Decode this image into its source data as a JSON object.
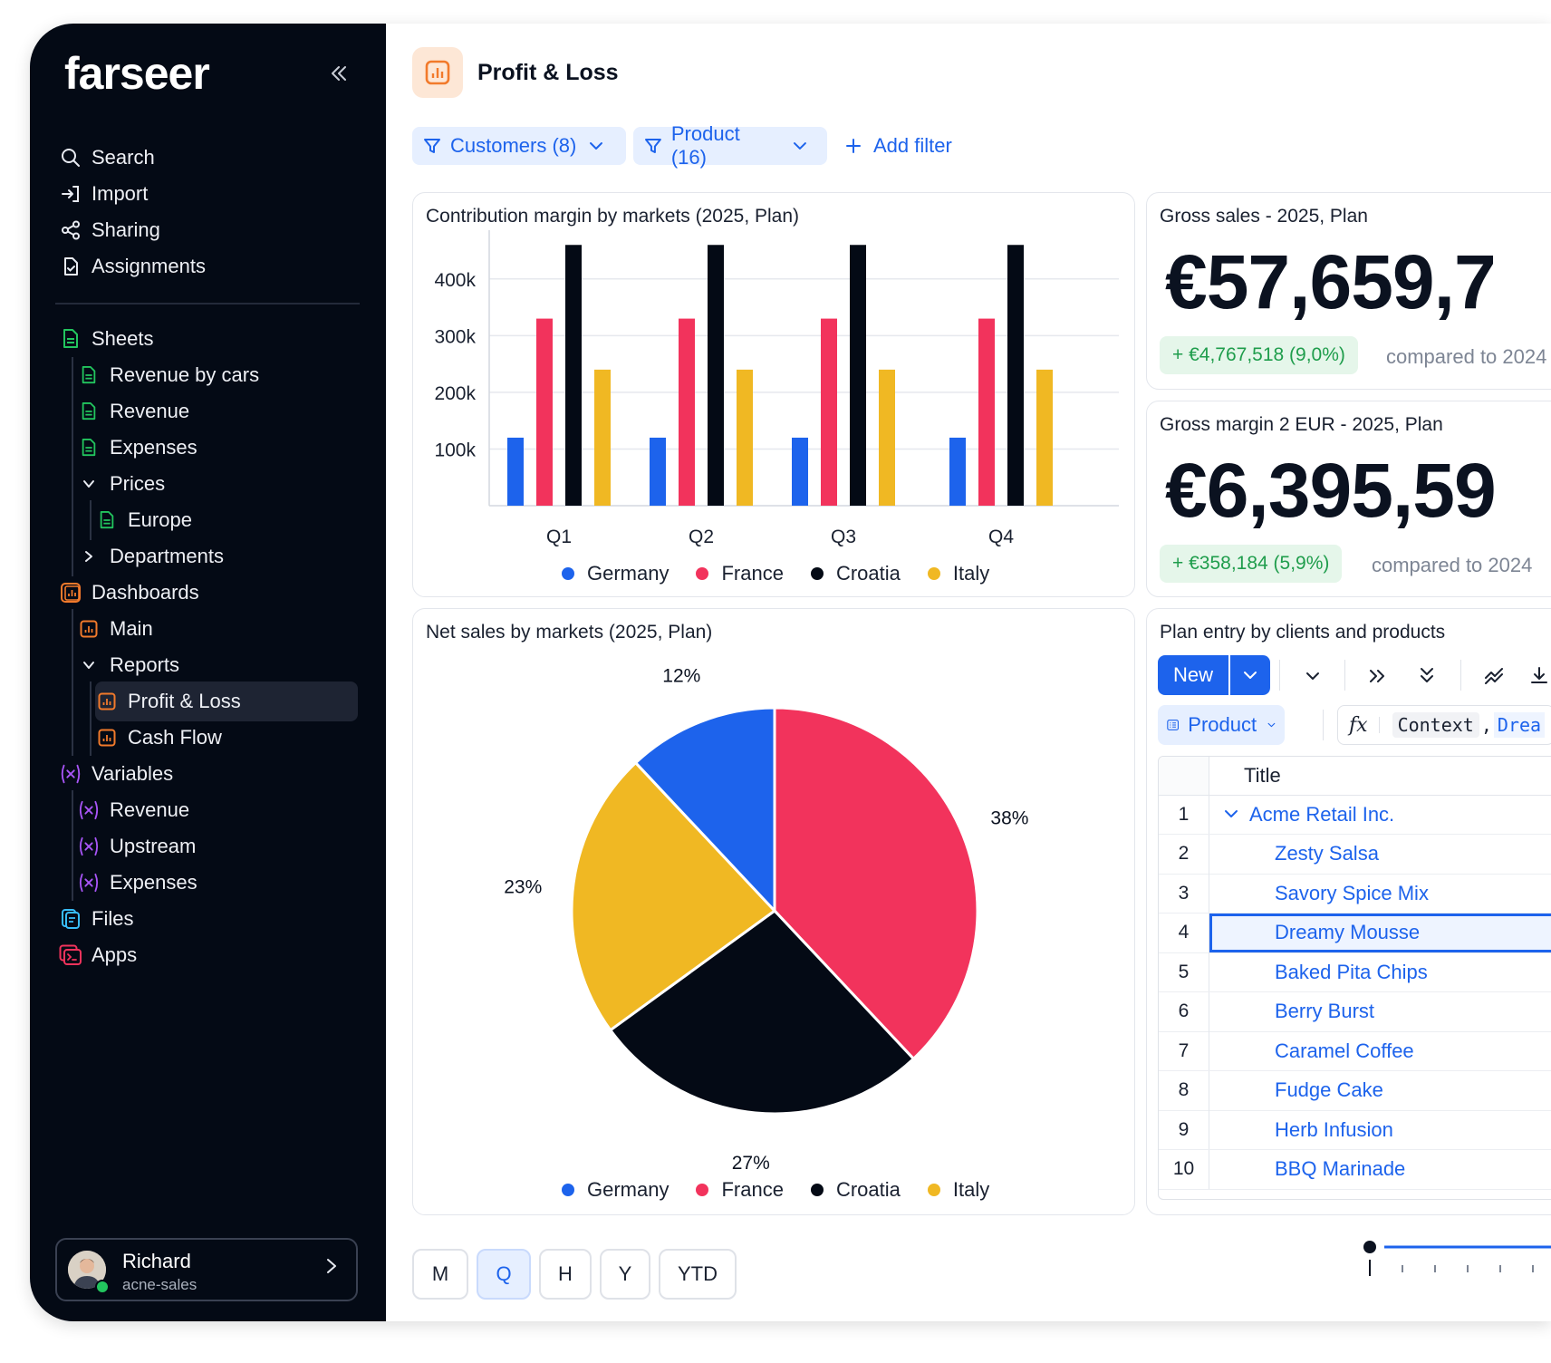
{
  "app": {
    "logo": "farseer",
    "collapse_icon": "double-chevron-left-icon"
  },
  "sidebar": {
    "top_items": [
      {
        "label": "Search",
        "icon": "search-icon"
      },
      {
        "label": "Import",
        "icon": "import-icon"
      },
      {
        "label": "Sharing",
        "icon": "share-icon"
      },
      {
        "label": "Assignments",
        "icon": "assignment-icon"
      }
    ],
    "tree": {
      "sheets": "Sheets",
      "revenue_by_cars": "Revenue by cars",
      "revenue": "Revenue",
      "expenses": "Expenses",
      "prices": "Prices",
      "europe": "Europe",
      "departments": "Departments",
      "dashboards": "Dashboards",
      "main": "Main",
      "reports": "Reports",
      "profit_loss": "Profit & Loss",
      "cash_flow": "Cash Flow",
      "variables": "Variables",
      "var_revenue": "Revenue",
      "var_upstream": "Upstream",
      "var_expenses": "Expenses",
      "files": "Files",
      "apps": "Apps"
    },
    "user": {
      "name": "Richard",
      "role": "acne-sales"
    }
  },
  "header": {
    "title": "Profit & Loss",
    "filters": [
      {
        "label": "Customers (8)"
      },
      {
        "label": "Product (16)"
      }
    ],
    "add_filter": "Add filter"
  },
  "colors": {
    "germany": "#1d63ec",
    "france": "#f2335c",
    "croatia": "#040a15",
    "italy": "#f0b823",
    "accent": "#1d63ec"
  },
  "bar_card": {
    "title": "Contribution margin by markets (2025, Plan)"
  },
  "kpi1": {
    "title": "Gross sales - 2025, Plan",
    "value": "€57,659,7",
    "delta": "+ €4,767,518 (9,0%)",
    "compare": "compared to 2024"
  },
  "kpi2": {
    "title": "Gross margin 2 EUR - 2025, Plan",
    "value": "€6,395,59",
    "delta": "+ €358,184 (5,9%)",
    "compare": "compared to 2024"
  },
  "pie_card": {
    "title": "Net sales by markets (2025, Plan)"
  },
  "legend": [
    "Germany",
    "France",
    "Croatia",
    "Italy"
  ],
  "chart_data": [
    {
      "type": "bar",
      "title": "Contribution margin by markets (2025, Plan)",
      "categories": [
        "Q1",
        "Q2",
        "Q3",
        "Q4"
      ],
      "yticks": [
        "100k",
        "200k",
        "300k",
        "400k"
      ],
      "ylim": [
        0,
        470000
      ],
      "grid": true,
      "legend_position": "bottom",
      "series": [
        {
          "name": "Germany",
          "color": "#1d63ec",
          "values": [
            120000,
            120000,
            120000,
            120000
          ]
        },
        {
          "name": "France",
          "color": "#f2335c",
          "values": [
            330000,
            330000,
            330000,
            330000
          ]
        },
        {
          "name": "Croatia",
          "color": "#040a15",
          "values": [
            460000,
            460000,
            460000,
            460000
          ]
        },
        {
          "name": "Italy",
          "color": "#f0b823",
          "values": [
            240000,
            240000,
            240000,
            240000
          ]
        }
      ]
    },
    {
      "type": "pie",
      "title": "Net sales by markets (2025, Plan)",
      "legend_position": "bottom",
      "slices": [
        {
          "name": "France",
          "value": 38,
          "label": "38%",
          "color": "#f2335c"
        },
        {
          "name": "Croatia",
          "value": 27,
          "label": "27%",
          "color": "#040a15"
        },
        {
          "name": "Italy",
          "value": 23,
          "label": "23%",
          "color": "#f0b823"
        },
        {
          "name": "Germany",
          "value": 12,
          "label": "12%",
          "color": "#1d63ec"
        }
      ]
    }
  ],
  "plan_card": {
    "title": "Plan entry by clients and products",
    "new_label": "New",
    "product_label": "Product",
    "formula_context": "Context",
    "formula_sep": ",",
    "formula_arg": "Drea",
    "column_title": "Title",
    "rows": [
      {
        "n": "1",
        "title": "Acme Retail Inc."
      },
      {
        "n": "2",
        "title": "Zesty Salsa"
      },
      {
        "n": "3",
        "title": "Savory Spice Mix"
      },
      {
        "n": "4",
        "title": "Dreamy Mousse"
      },
      {
        "n": "5",
        "title": "Baked Pita Chips"
      },
      {
        "n": "6",
        "title": "Berry Burst"
      },
      {
        "n": "7",
        "title": "Caramel Coffee"
      },
      {
        "n": "8",
        "title": "Fudge Cake"
      },
      {
        "n": "9",
        "title": "Herb Infusion"
      },
      {
        "n": "10",
        "title": "BBQ Marinade"
      }
    ]
  },
  "periods": [
    "M",
    "Q",
    "H",
    "Y",
    "YTD"
  ],
  "selected_period": "Q"
}
